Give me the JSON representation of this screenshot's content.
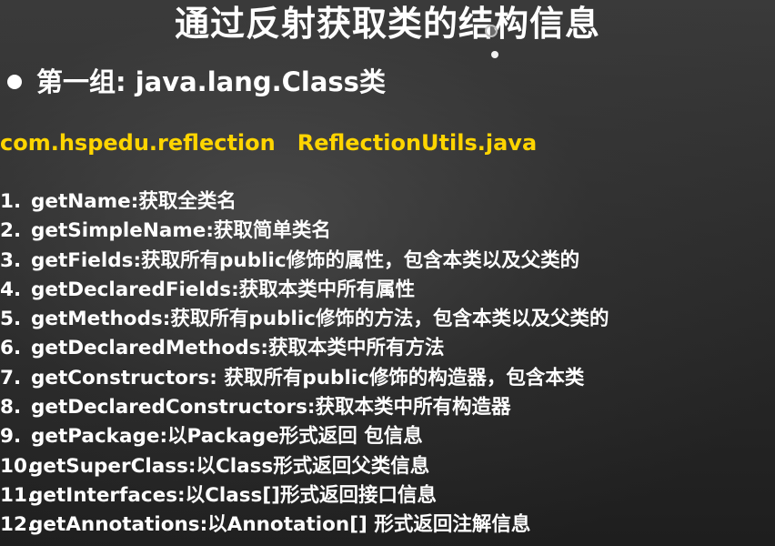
{
  "slide": {
    "title": "通过反射获取类的结构信息",
    "section_heading": "第一组: java.lang.Class类",
    "package_path": "com.hspedu.reflection",
    "file_name": "ReflectionUtils.java",
    "methods": [
      {
        "num": "1.",
        "text": "getName:获取全类名"
      },
      {
        "num": "2.",
        "text": "getSimpleName:获取简单类名"
      },
      {
        "num": "3.",
        "text": "getFields:获取所有public修饰的属性，包含本类以及父类的"
      },
      {
        "num": "4.",
        "text": "getDeclaredFields:获取本类中所有属性"
      },
      {
        "num": "5.",
        "text": "getMethods:获取所有public修饰的方法，包含本类以及父类的"
      },
      {
        "num": "6.",
        "text": "getDeclaredMethods:获取本类中所有方法"
      },
      {
        "num": "7.",
        "text": "getConstructors: 获取所有public修饰的构造器，包含本类"
      },
      {
        "num": "8.",
        "text": "getDeclaredConstructors:获取本类中所有构造器"
      },
      {
        "num": "9.",
        "text": "getPackage:以Package形式返回 包信息"
      },
      {
        "num": "10.",
        "text": "getSuperClass:以Class形式返回父类信息"
      },
      {
        "num": "11.",
        "text": "getInterfaces:以Class[]形式返回接口信息"
      },
      {
        "num": "12.",
        "text": "getAnnotations:以Annotation[] 形式返回注解信息"
      }
    ]
  },
  "colors": {
    "text": "#ffffff",
    "highlight": "#ffd500",
    "background": "#2c2c2c"
  }
}
